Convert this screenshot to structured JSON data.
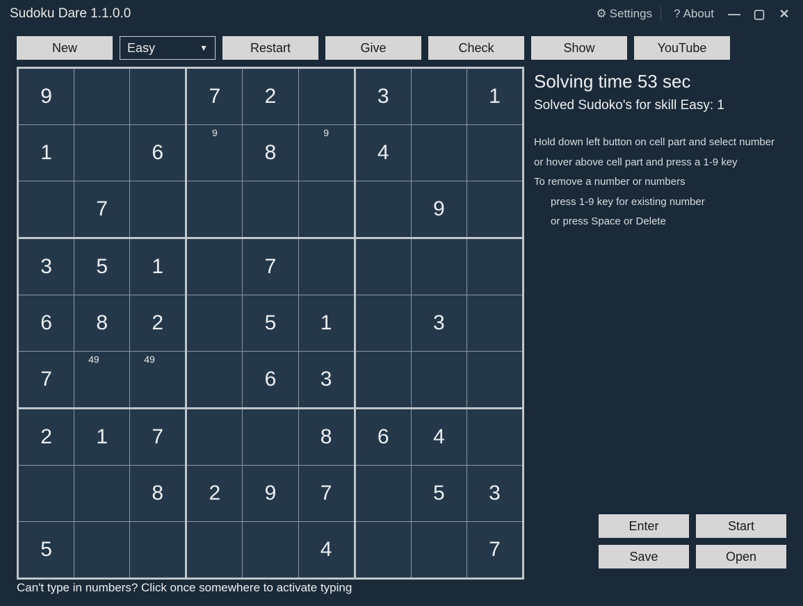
{
  "titlebar": {
    "title": "Sudoku Dare 1.1.0.0",
    "settings_label": "Settings",
    "about_label": "About"
  },
  "toolbar": {
    "new_label": "New",
    "difficulty_selected": "Easy",
    "restart_label": "Restart",
    "give_label": "Give",
    "check_label": "Check",
    "show_label": "Show",
    "youtube_label": "YouTube"
  },
  "side": {
    "solving_time": "Solving time 53 sec",
    "solved_count": "Solved Sudoko's for skill Easy: 1",
    "help1": "Hold down left button on cell part and select number",
    "help2": "or hover above cell part and press a 1-9 key",
    "help3": "To remove a number or numbers",
    "help4": "press 1-9 key for existing number",
    "help5": "or press Space or Delete",
    "enter_label": "Enter",
    "start_label": "Start",
    "save_label": "Save",
    "open_label": "Open"
  },
  "footer_hint": "Can't type in numbers? Click once somewhere to activate typing",
  "sudoku": {
    "values": [
      [
        "9",
        "",
        "",
        "7",
        "2",
        "",
        "3",
        "",
        "1"
      ],
      [
        "1",
        "",
        "6",
        "",
        "8",
        "",
        "4",
        "",
        ""
      ],
      [
        "",
        "7",
        "",
        "",
        "",
        "",
        "",
        "9",
        ""
      ],
      [
        "3",
        "5",
        "1",
        "",
        "7",
        "",
        "",
        "",
        ""
      ],
      [
        "6",
        "8",
        "2",
        "",
        "5",
        "1",
        "",
        "3",
        ""
      ],
      [
        "7",
        "",
        "",
        "",
        "6",
        "3",
        "",
        "",
        ""
      ],
      [
        "2",
        "1",
        "7",
        "",
        "",
        "8",
        "6",
        "4",
        ""
      ],
      [
        "",
        "",
        "8",
        "2",
        "9",
        "7",
        "",
        "5",
        "3"
      ],
      [
        "5",
        "",
        "",
        "",
        "",
        "4",
        "",
        "",
        "7"
      ]
    ],
    "notes": {
      "r1c3": "9",
      "r1c5": "9",
      "r5c1": "49",
      "r5c2": "49"
    }
  }
}
